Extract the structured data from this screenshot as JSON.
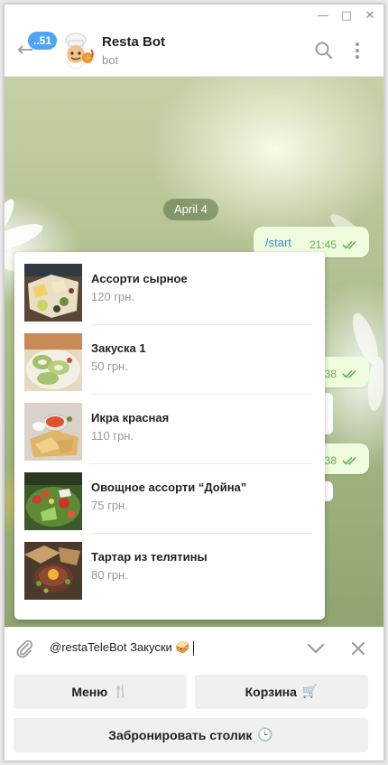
{
  "window": {
    "controls": {
      "minimize_glyph": "—",
      "maximize_glyph": "□",
      "close_glyph": "✕"
    }
  },
  "header": {
    "back_glyph": "←",
    "unread_count": "..51",
    "chat_title": "Resta Bot",
    "chat_subtitle": "bot",
    "icons": [
      "arrow-left-icon",
      "search-icon",
      "more-vertical-icon"
    ]
  },
  "chat": {
    "date_separator": "April 4",
    "outgoing_message": {
      "text": "/start",
      "time": "21:45"
    },
    "partial_times": [
      "38",
      "38"
    ],
    "colors": {
      "outgoing_bubble": "#effdde",
      "time_text": "#62ac55",
      "link": "#3a8bd6"
    }
  },
  "inline_results": {
    "items": [
      {
        "title": "Ассорти сырное",
        "price": "120 грн."
      },
      {
        "title": "Закуска 1",
        "price": "50 грн."
      },
      {
        "title": "Икра красная",
        "price": "110 грн."
      },
      {
        "title": "Овощное ассорти “Дойна”",
        "price": "75 грн."
      },
      {
        "title": "Тартар из телятины",
        "price": "80 грн."
      }
    ]
  },
  "composer": {
    "input_value": "@restaTeleBot Закуски 🥪",
    "icons": [
      "paperclip-icon",
      "chevron-down-icon",
      "close-icon"
    ]
  },
  "reply_keyboard": {
    "menu": {
      "label": "Меню",
      "emoji": "🍴"
    },
    "cart": {
      "label": "Корзина",
      "emoji": "🛒"
    },
    "book": {
      "label": "Забронировать столик",
      "emoji": "🕒"
    }
  },
  "accent_colors": {
    "badge": "#4ea4f6",
    "date_pill": "#587046"
  }
}
